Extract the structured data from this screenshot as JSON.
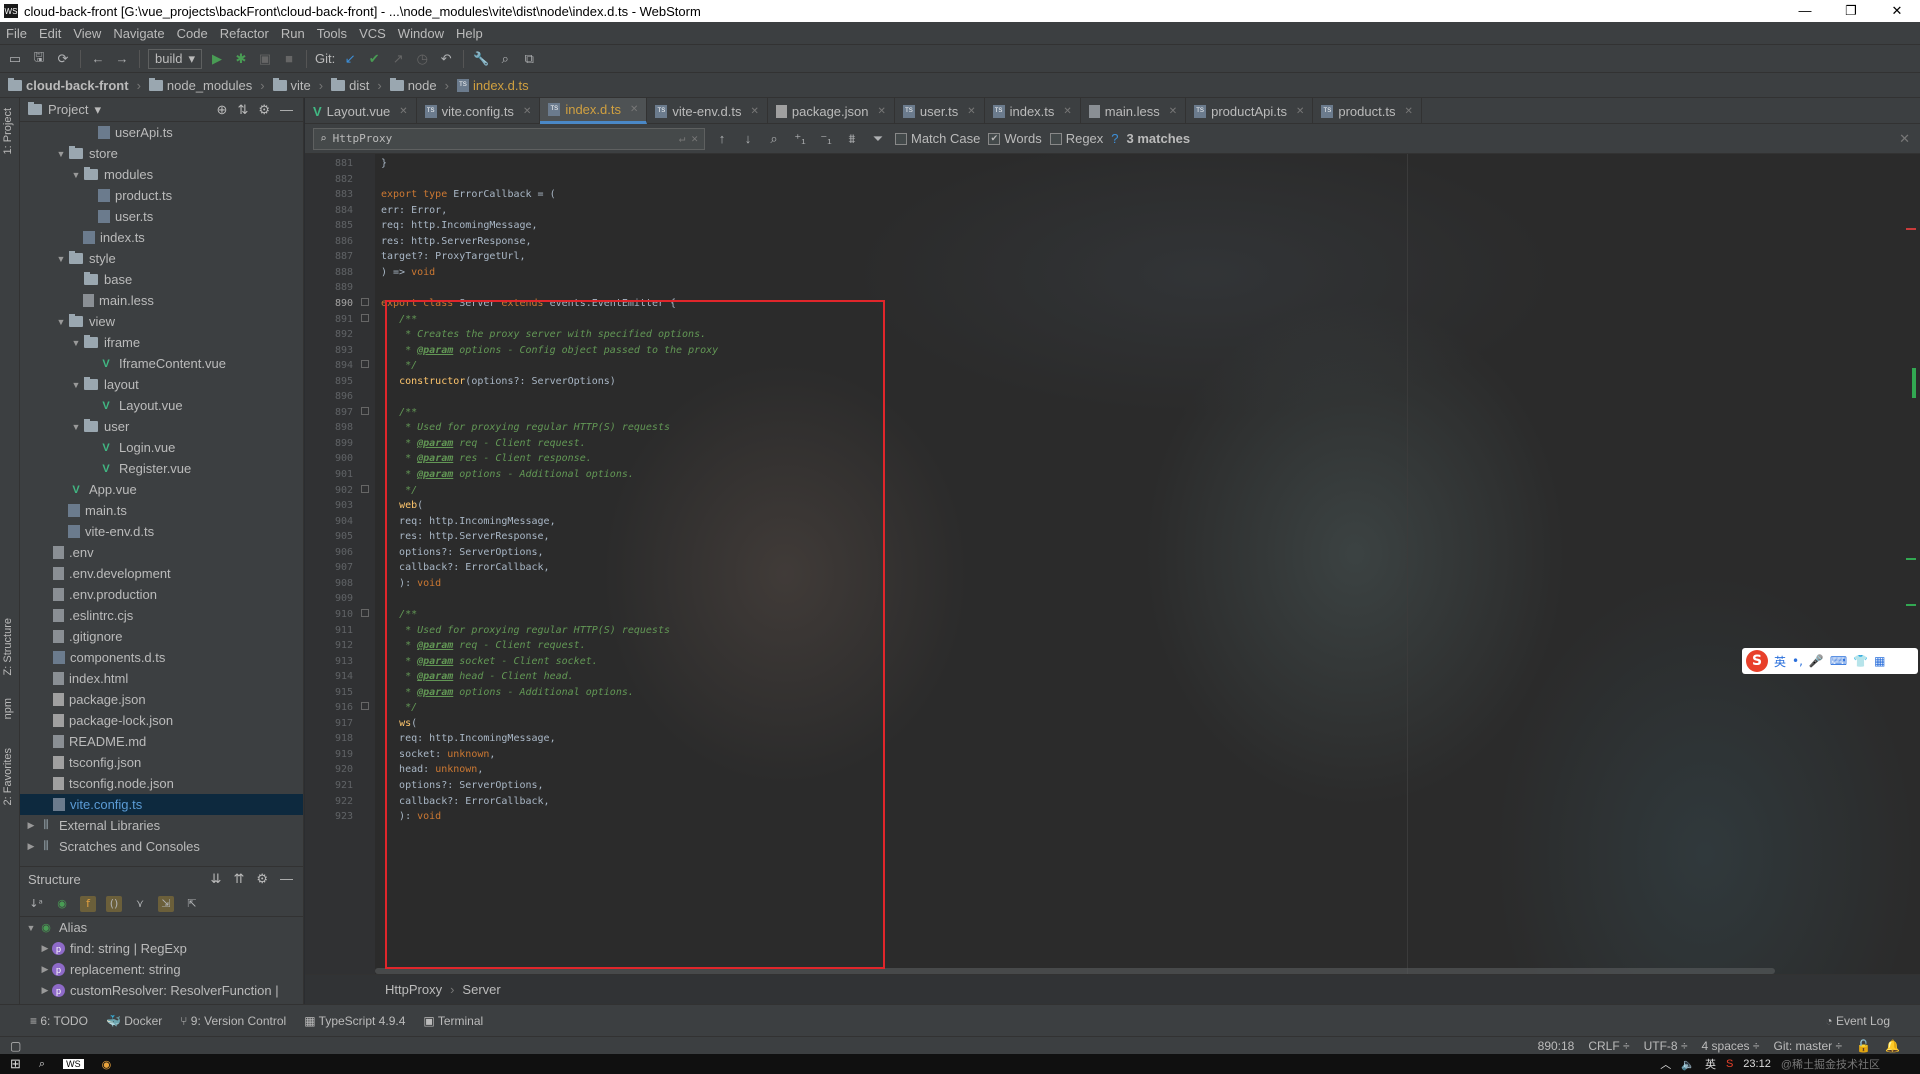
{
  "window": {
    "title": "cloud-back-front [G:\\vue_projects\\backFront\\cloud-back-front] - ...\\node_modules\\vite\\dist\\node\\index.d.ts - WebStorm",
    "app_icon": "WS",
    "controls": [
      "—",
      "❐",
      "✕"
    ]
  },
  "menu": [
    "File",
    "Edit",
    "View",
    "Navigate",
    "Code",
    "Refactor",
    "Run",
    "Tools",
    "VCS",
    "Window",
    "Help"
  ],
  "toolbar": {
    "run_config": "build",
    "git_label": "Git:"
  },
  "breadcrumbs": [
    "cloud-back-front",
    "node_modules",
    "vite",
    "dist",
    "node",
    "index.d.ts"
  ],
  "left_strip": {
    "project_tab": "1: Project",
    "structure_tab": "Z: Structure",
    "npm_tab": "npm",
    "favorites_tab": "2: Favorites"
  },
  "project_panel": {
    "title": "Project",
    "tree": [
      {
        "label": "userApi.ts",
        "type": "ts",
        "depth": 4
      },
      {
        "label": "store",
        "type": "folder",
        "depth": 2,
        "expanded": true
      },
      {
        "label": "modules",
        "type": "folder",
        "depth": 3,
        "expanded": true
      },
      {
        "label": "product.ts",
        "type": "ts",
        "depth": 4
      },
      {
        "label": "user.ts",
        "type": "ts",
        "depth": 4
      },
      {
        "label": "index.ts",
        "type": "ts",
        "depth": 3
      },
      {
        "label": "style",
        "type": "folder",
        "depth": 2,
        "expanded": true
      },
      {
        "label": "base",
        "type": "folder",
        "depth": 3
      },
      {
        "label": "main.less",
        "type": "file",
        "depth": 3
      },
      {
        "label": "view",
        "type": "folder",
        "depth": 2,
        "expanded": true
      },
      {
        "label": "iframe",
        "type": "folder",
        "depth": 3,
        "expanded": true
      },
      {
        "label": "IframeContent.vue",
        "type": "vue",
        "depth": 4
      },
      {
        "label": "layout",
        "type": "folder",
        "depth": 3,
        "expanded": true
      },
      {
        "label": "Layout.vue",
        "type": "vue",
        "depth": 4
      },
      {
        "label": "user",
        "type": "folder",
        "depth": 3,
        "expanded": true
      },
      {
        "label": "Login.vue",
        "type": "vue",
        "depth": 4
      },
      {
        "label": "Register.vue",
        "type": "vue",
        "depth": 4
      },
      {
        "label": "App.vue",
        "type": "vue",
        "depth": 2
      },
      {
        "label": "main.ts",
        "type": "ts",
        "depth": 2
      },
      {
        "label": "vite-env.d.ts",
        "type": "ts",
        "depth": 2
      },
      {
        "label": ".env",
        "type": "file",
        "depth": 1
      },
      {
        "label": ".env.development",
        "type": "file",
        "depth": 1
      },
      {
        "label": ".env.production",
        "type": "file",
        "depth": 1
      },
      {
        "label": ".eslintrc.cjs",
        "type": "file",
        "depth": 1
      },
      {
        "label": ".gitignore",
        "type": "file",
        "depth": 1
      },
      {
        "label": "components.d.ts",
        "type": "ts",
        "depth": 1
      },
      {
        "label": "index.html",
        "type": "file",
        "depth": 1
      },
      {
        "label": "package.json",
        "type": "json",
        "depth": 1
      },
      {
        "label": "package-lock.json",
        "type": "json",
        "depth": 1
      },
      {
        "label": "README.md",
        "type": "file",
        "depth": 1
      },
      {
        "label": "tsconfig.json",
        "type": "json",
        "depth": 1
      },
      {
        "label": "tsconfig.node.json",
        "type": "json",
        "depth": 1
      },
      {
        "label": "vite.config.ts",
        "type": "ts",
        "depth": 1,
        "selected": true
      },
      {
        "label": "External Libraries",
        "type": "lib",
        "depth": 0
      },
      {
        "label": "Scratches and Consoles",
        "type": "lib",
        "depth": 0
      }
    ]
  },
  "structure_panel": {
    "title": "Structure",
    "items": [
      {
        "label": "Alias",
        "depth": 0,
        "expanded": true
      },
      {
        "label": "find: string | RegExp",
        "depth": 1
      },
      {
        "label": "replacement: string",
        "depth": 1
      },
      {
        "label": "customResolver: ResolverFunction |",
        "depth": 1
      }
    ]
  },
  "tabs": [
    {
      "label": "Layout.vue",
      "type": "vue"
    },
    {
      "label": "vite.config.ts",
      "type": "ts"
    },
    {
      "label": "index.d.ts",
      "type": "ts",
      "active": true
    },
    {
      "label": "vite-env.d.ts",
      "type": "ts"
    },
    {
      "label": "package.json",
      "type": "json"
    },
    {
      "label": "user.ts",
      "type": "ts"
    },
    {
      "label": "index.ts",
      "type": "ts"
    },
    {
      "label": "main.less",
      "type": "file"
    },
    {
      "label": "productApi.ts",
      "type": "ts"
    },
    {
      "label": "product.ts",
      "type": "ts"
    }
  ],
  "find": {
    "query": "HttpProxy",
    "match_case": "Match Case",
    "words": "Words",
    "regex": "Regex",
    "help": "?",
    "result": "3 matches"
  },
  "code": {
    "current_line": "890",
    "lines": [
      {
        "n": "881",
        "html": "}"
      },
      {
        "n": "882",
        "html": ""
      },
      {
        "n": "883",
        "html": "<span class='kw'>export type</span> ErrorCallback = ("
      },
      {
        "n": "884",
        "html": "err: Error,"
      },
      {
        "n": "885",
        "html": "req: http.IncomingMessage,"
      },
      {
        "n": "886",
        "html": "res: http.ServerResponse,"
      },
      {
        "n": "887",
        "html": "target?: ProxyTargetUrl,"
      },
      {
        "n": "888",
        "html": ") => <span class='kw'>void</span>"
      },
      {
        "n": "889",
        "html": ""
      },
      {
        "n": "890",
        "html": "<span class='kw'>export class</span> Server <span class='kw'>extends</span> events.EventEmitter {"
      },
      {
        "n": "891",
        "html": "   <span class='cm'>/**</span>"
      },
      {
        "n": "892",
        "html": "    <span class='cm'>* Creates the proxy server with specified options.</span>"
      },
      {
        "n": "893",
        "html": "    <span class='cm'>* <span class='tag'>@param</span> options - Config object passed to the proxy</span>"
      },
      {
        "n": "894",
        "html": "    <span class='cm'>*/</span>"
      },
      {
        "n": "895",
        "html": "   <span class='fn'>constructor</span>(options?: ServerOptions)"
      },
      {
        "n": "896",
        "html": ""
      },
      {
        "n": "897",
        "html": "   <span class='cm'>/**</span>"
      },
      {
        "n": "898",
        "html": "    <span class='cm'>* Used for proxying regular HTTP(S) requests</span>"
      },
      {
        "n": "899",
        "html": "    <span class='cm'>* <span class='tag'>@param</span> req - Client request.</span>"
      },
      {
        "n": "900",
        "html": "    <span class='cm'>* <span class='tag'>@param</span> res - Client response.</span>"
      },
      {
        "n": "901",
        "html": "    <span class='cm'>* <span class='tag'>@param</span> options - Additional options.</span>"
      },
      {
        "n": "902",
        "html": "    <span class='cm'>*/</span>"
      },
      {
        "n": "903",
        "html": "   <span class='fn'>web</span>("
      },
      {
        "n": "904",
        "html": "   req: http.IncomingMessage,"
      },
      {
        "n": "905",
        "html": "   res: http.ServerResponse,"
      },
      {
        "n": "906",
        "html": "   options?: ServerOptions,"
      },
      {
        "n": "907",
        "html": "   callback?: ErrorCallback,"
      },
      {
        "n": "908",
        "html": "   ): <span class='kw'>void</span>"
      },
      {
        "n": "909",
        "html": ""
      },
      {
        "n": "910",
        "html": "   <span class='cm'>/**</span>"
      },
      {
        "n": "911",
        "html": "    <span class='cm'>* Used for proxying regular HTTP(S) requests</span>"
      },
      {
        "n": "912",
        "html": "    <span class='cm'>* <span class='tag'>@param</span> req - Client request.</span>"
      },
      {
        "n": "913",
        "html": "    <span class='cm'>* <span class='tag'>@param</span> socket - Client socket.</span>"
      },
      {
        "n": "914",
        "html": "    <span class='cm'>* <span class='tag'>@param</span> head - Client head.</span>"
      },
      {
        "n": "915",
        "html": "    <span class='cm'>* <span class='tag'>@param</span> options - Additional options.</span>"
      },
      {
        "n": "916",
        "html": "    <span class='cm'>*/</span>"
      },
      {
        "n": "917",
        "html": "   <span class='fn'>ws</span>("
      },
      {
        "n": "918",
        "html": "   req: http.IncomingMessage,"
      },
      {
        "n": "919",
        "html": "   socket: <span class='kw'>unknown</span>,"
      },
      {
        "n": "920",
        "html": "   head: <span class='kw'>unknown</span>,"
      },
      {
        "n": "921",
        "html": "   options?: ServerOptions,"
      },
      {
        "n": "922",
        "html": "   callback?: ErrorCallback,"
      },
      {
        "n": "923",
        "html": "   ): <span class='kw'>void</span>"
      }
    ]
  },
  "editor_breadcrumb": [
    "HttpProxy",
    "Server"
  ],
  "bottom_tools": [
    {
      "icon": "≡",
      "label": "6: TODO"
    },
    {
      "icon": "🐳",
      "label": "Docker"
    },
    {
      "icon": "⑂",
      "label": "9: Version Control"
    },
    {
      "icon": "▦",
      "label": "TypeScript 4.9.4"
    },
    {
      "icon": "▣",
      "label": "Terminal"
    }
  ],
  "event_log": "Event Log",
  "status": {
    "position": "890:18",
    "line_sep": "CRLF ÷",
    "encoding": "UTF-8 ÷",
    "indent": "4 spaces ÷",
    "git": "Git: master ÷"
  },
  "ime": {
    "logo": "S",
    "mode": "英"
  },
  "taskbar": {
    "clock": "23:12",
    "lang": "英",
    "watermark": "@稀土掘金技术社区"
  },
  "colors": {
    "selection_box": "#e0262b",
    "active_tab_accent": "#4a88c7",
    "keyword": "#cc7832",
    "comment": "#629755"
  }
}
